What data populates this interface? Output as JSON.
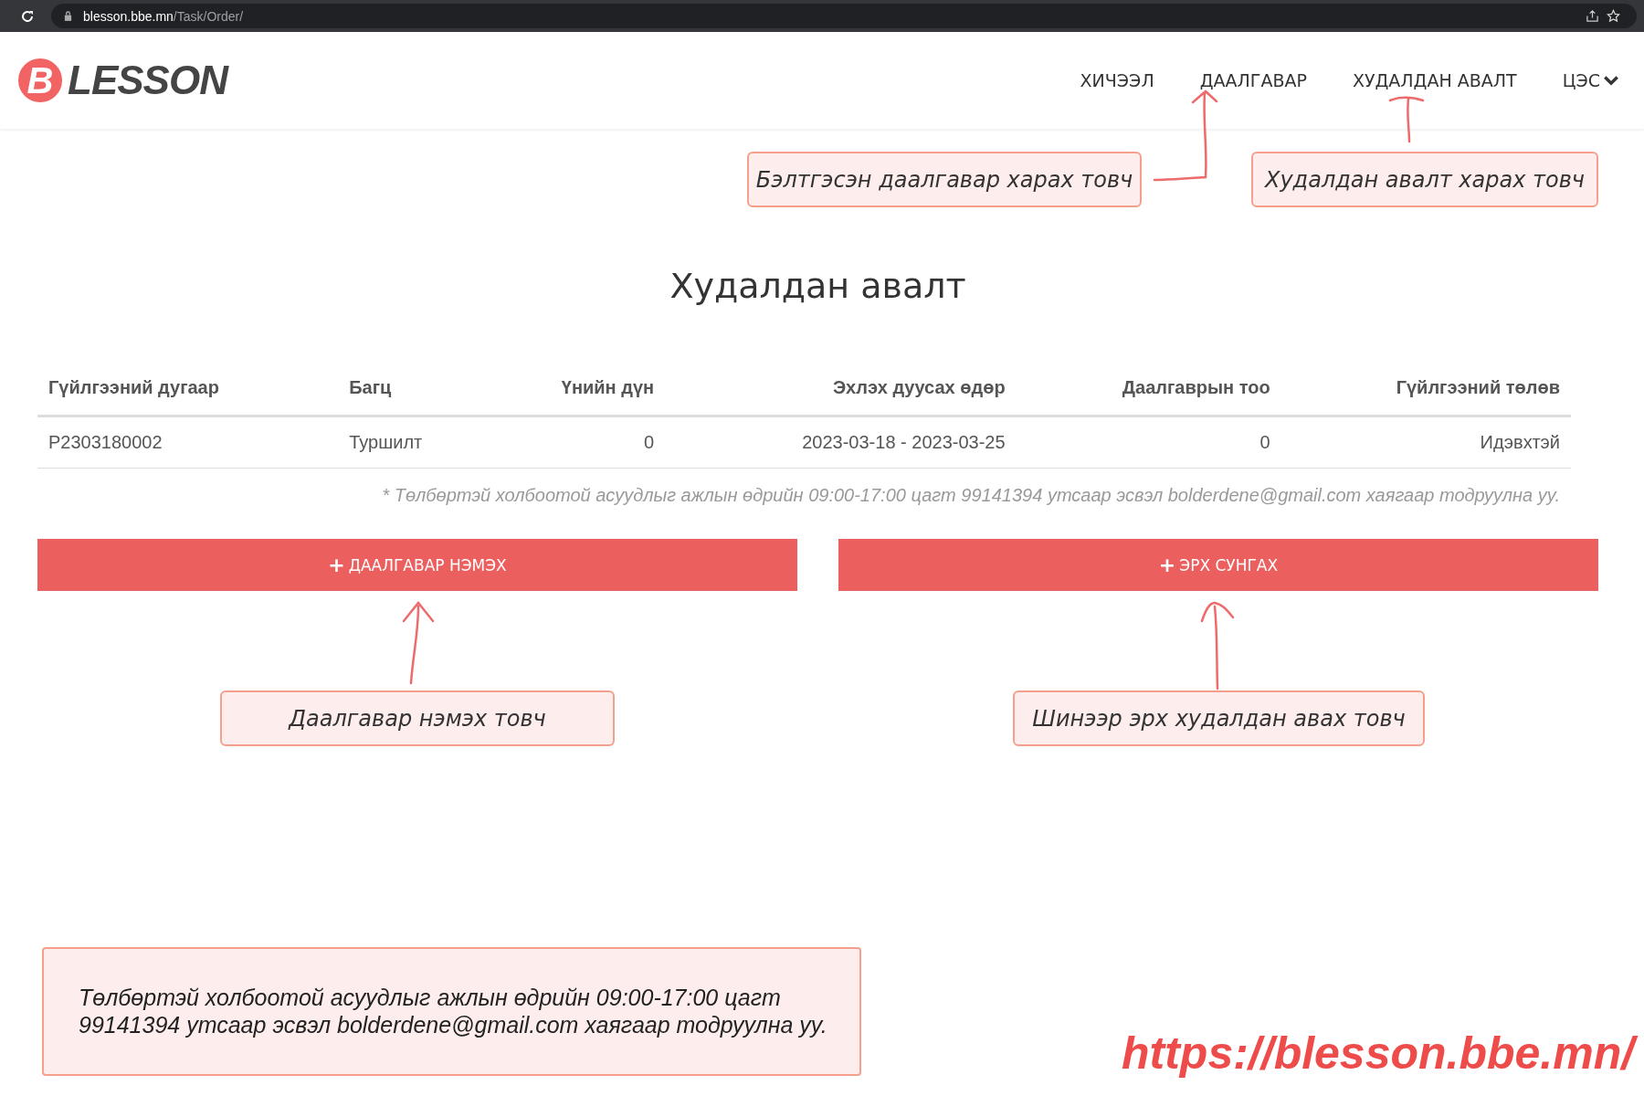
{
  "browser": {
    "url_host": "blesson.bbe.mn",
    "url_path": "/Task/Order/"
  },
  "header": {
    "logo_letter": "B",
    "logo_text": "LESSON",
    "nav": [
      {
        "label": "ХИЧЭЭЛ",
        "dropdown": false
      },
      {
        "label": "ДААЛГАВАР",
        "dropdown": false
      },
      {
        "label": "ХУДАЛДАН АВАЛТ",
        "dropdown": false
      },
      {
        "label": "ЦЭС",
        "dropdown": true
      }
    ]
  },
  "page": {
    "title": "Худалдан авалт",
    "table": {
      "columns": [
        "Гүйлгээний дугаар",
        "Багц",
        "Үнийн дүн",
        "Эхлэх дуусах өдөр",
        "Даалгаврын тоо",
        "Гүйлгээний төлөв"
      ],
      "rows": [
        [
          "P2303180002",
          "Туршилт",
          "0",
          "2023-03-18 - 2023-03-25",
          "0",
          "Идэвхтэй"
        ]
      ]
    },
    "note": "* Төлбөртэй холбоотой асуудлыг ажлын өдрийн 09:00-17:00 цагт 99141394 утсаар эсвэл bolderdene@gmail.com хаягаар тодруулна уу.",
    "buttons": [
      {
        "icon": "+",
        "label": "ДААЛГАВАР НЭМЭХ"
      },
      {
        "icon": "+",
        "label": "ЭРХ СУНГАХ"
      }
    ]
  },
  "annotations": [
    {
      "text": "Бэлтгэсэн даалгавар харах товч"
    },
    {
      "text": "Худалдан авалт харах товч"
    },
    {
      "text": "Даалгавар нэмэх товч"
    },
    {
      "text": "Шинээр эрх худалдан авах товч"
    }
  ],
  "info_box": {
    "lines": [
      "Төлбөртэй холбоотой асуудлыг ажлын өдрийн 09:00-17:00 цагт",
      "99141394 утсаар эсвэл bolderdene@gmail.com хаягаар тодруулна уу."
    ]
  },
  "site_url": "https://blesson.bbe.mn/"
}
